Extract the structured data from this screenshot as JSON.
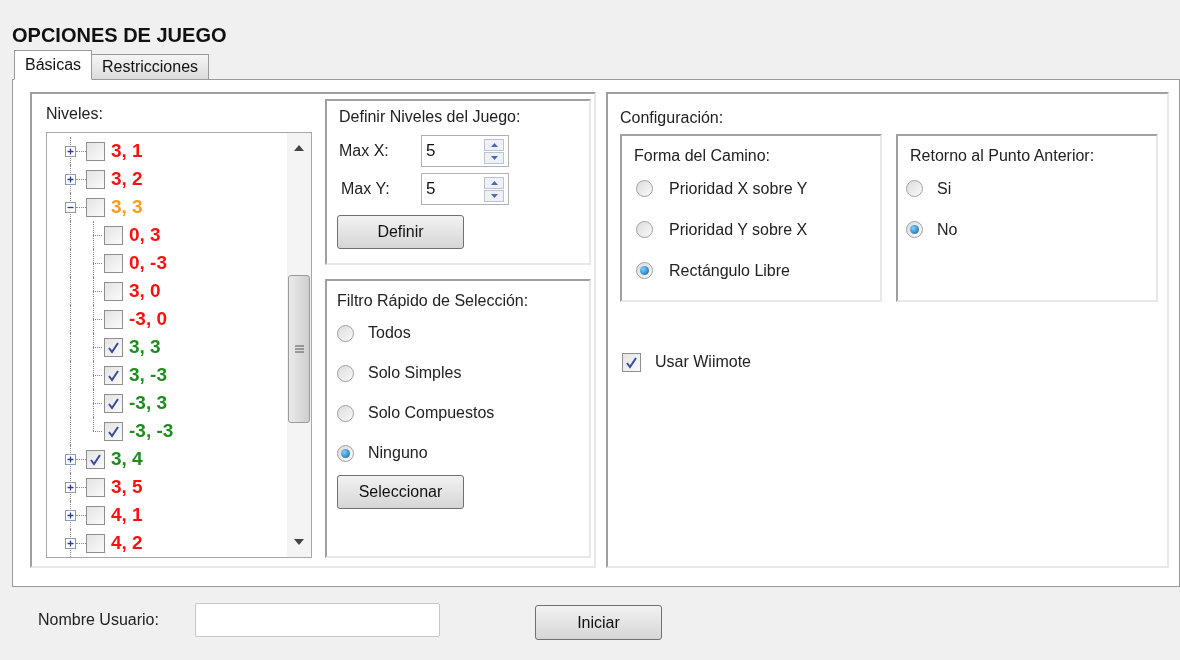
{
  "title": "OPCIONES DE JUEGO",
  "tabs": [
    {
      "label": "Básicas",
      "selected": true
    },
    {
      "label": "Restricciones",
      "selected": false
    }
  ],
  "levels": {
    "label": "Niveles:",
    "tree": [
      {
        "label": "3, 1",
        "color": "#ff1010",
        "checked": false,
        "expanded": false
      },
      {
        "label": "3, 2",
        "color": "#ff1010",
        "checked": false,
        "expanded": false
      },
      {
        "label": "3, 3",
        "color": "#ff9a1a",
        "checked": false,
        "expanded": true,
        "children": [
          {
            "label": "0, 3",
            "color": "#ff1010",
            "checked": false
          },
          {
            "label": "0, -3",
            "color": "#ff1010",
            "checked": false
          },
          {
            "label": "3, 0",
            "color": "#ff1010",
            "checked": false
          },
          {
            "label": "-3, 0",
            "color": "#ff1010",
            "checked": false
          },
          {
            "label": "3, 3",
            "color": "#1e8c1e",
            "checked": true
          },
          {
            "label": "3, -3",
            "color": "#1e8c1e",
            "checked": true
          },
          {
            "label": "-3, 3",
            "color": "#1e8c1e",
            "checked": true
          },
          {
            "label": "-3, -3",
            "color": "#1e8c1e",
            "checked": true
          }
        ]
      },
      {
        "label": "3, 4",
        "color": "#1e8c1e",
        "checked": true,
        "expanded": false
      },
      {
        "label": "3, 5",
        "color": "#ff1010",
        "checked": false,
        "expanded": false
      },
      {
        "label": "4, 1",
        "color": "#ff1010",
        "checked": false,
        "expanded": false
      },
      {
        "label": "4, 2",
        "color": "#ff1010",
        "checked": false,
        "expanded": false
      }
    ]
  },
  "define_levels": {
    "title": "Definir Niveles del Juego:",
    "fields": [
      {
        "label": "Max X:",
        "value": "5"
      },
      {
        "label": "Max Y:",
        "value": "5"
      }
    ],
    "button": "Definir"
  },
  "quick_filter": {
    "title": "Filtro Rápido de Selección:",
    "options": [
      {
        "label": "Todos",
        "selected": false
      },
      {
        "label": "Solo Simples",
        "selected": false
      },
      {
        "label": "Solo Compuestos",
        "selected": false
      },
      {
        "label": "Ninguno",
        "selected": true
      }
    ],
    "button": "Seleccionar"
  },
  "configuration": {
    "title": "Configuración:",
    "path_shape": {
      "title": "Forma del Camino:",
      "options": [
        {
          "label": "Prioridad X sobre Y",
          "selected": false
        },
        {
          "label": "Prioridad Y sobre X",
          "selected": false
        },
        {
          "label": "Rectángulo Libre",
          "selected": true
        }
      ]
    },
    "return_to_previous": {
      "title": "Retorno al Punto Anterior:",
      "options": [
        {
          "label": "Si",
          "selected": false
        },
        {
          "label": "No",
          "selected": true
        }
      ]
    },
    "use_wiimote": {
      "label": "Usar Wiimote",
      "checked": true
    }
  },
  "footer": {
    "username_label": "Nombre Usuario:",
    "start_button": "Iniciar"
  }
}
